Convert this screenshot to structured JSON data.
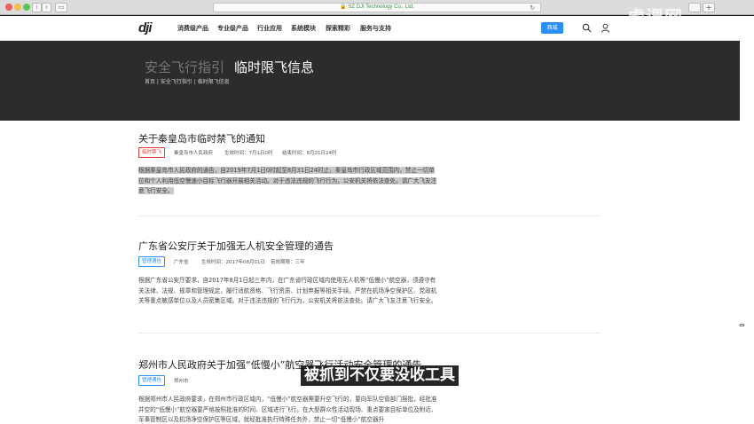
{
  "browser": {
    "url": "SZ DJI Technology Co., Ltd."
  },
  "watermark": "虎课网",
  "nav": {
    "logo": "dji",
    "items": [
      "消费级产品",
      "专业级产品",
      "行业应用",
      "系统模块",
      "探索精彩",
      "服务与支持"
    ],
    "store_label": "商城"
  },
  "banner": {
    "parent": "安全飞行指引",
    "title": "临时限飞信息",
    "breadcrumb": "首页 | 安全飞行指引 | 临时限飞信息"
  },
  "notices": [
    {
      "title": "关于秦皇岛市临时禁飞的通知",
      "tag": "临时禁飞",
      "meta": [
        "秦皇岛市人民政府",
        "生效时间：7月1日0时",
        "结束时间：8月31日24时"
      ],
      "body": "根据秦皇岛市人民政府的通告，自2019年7月1日0时起至8月31日24时止，秦皇岛市行政区域范围内，禁止一切单位和个人利用低空慢速小目标飞行器开展相关活动。对于违法违规的飞行行为，公安机关将依法查处。请广大飞友注意飞行安全。"
    },
    {
      "title": "广东省公安厅关于加强无人机安全管理的通告",
      "tag": "管理通告",
      "meta": [
        "广东省",
        "生效时间：2017年08月01日",
        "有效期限：三年"
      ],
      "body": "根据广东省公安厅要求，自2017年8月1日起三年内，在广东省行政区域内使用无人机等“低慢小”航空器，须遵守有关法律、法规、规章和管理规定，履行适航资格、飞行资质、计划申报等相关手续。严禁在机场净空保护区、党政机关等重点敏感单位以及人员密集区域。对于违法违规的飞行行为，公安机关将依法查处。请广大飞友注意飞行安全。"
    },
    {
      "title": "郑州市人民政府关于加强“低慢小”航空器飞行活动安全管理的通告",
      "tag": "管理通告",
      "meta": [
        "郑州市"
      ],
      "body": "根据郑州市人民政府要求，在郑州市行政区域内，“低慢小”航空器需要升空飞行的，要向军队空管部门报批，经批准并空的“低慢小”航空器要严格按照批准的时间、区域进行飞行。在大型群众性活动现场、重点要害目标单位及附近、军事管制区以及机场净空保护区等区域，就经批准执行特殊任务外，禁止一切“低慢小”航空器升"
    }
  ],
  "subtitle": "被抓到不仅要没收工具"
}
